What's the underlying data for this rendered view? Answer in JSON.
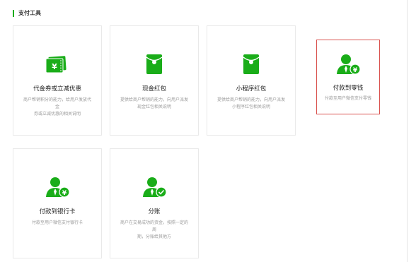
{
  "section": {
    "title": "支付工具"
  },
  "cards": [
    {
      "title": "代金券或立减优惠",
      "desc": "商户帮销积分的能力，给用户发放代金\n券或立减优惠的相关说明",
      "icon": "coupon-icon"
    },
    {
      "title": "现金红包",
      "desc": "提供给商户帮销的能力，向用户派发\n现金红包相关说明",
      "icon": "red-packet-icon"
    },
    {
      "title": "小程序红包",
      "desc": "提供给商户帮销的能力，向用户派发\n小程序红包相关说明",
      "icon": "mini-program-red-packet-icon"
    },
    {
      "title": "付款到零钱",
      "desc": "付款至用户微信支付零钱",
      "icon": "pay-to-balance-icon"
    },
    {
      "title": "付款到银行卡",
      "desc": "付款至用户微信支付银行卡",
      "icon": "pay-to-bank-card-icon"
    },
    {
      "title": "分账",
      "desc": "商户在交易成功的资金，按照一定的周\n期，分账给其他方",
      "icon": "profit-sharing-icon"
    }
  ],
  "colors": {
    "accent": "#1aad19",
    "highlight": "#d9534f"
  }
}
